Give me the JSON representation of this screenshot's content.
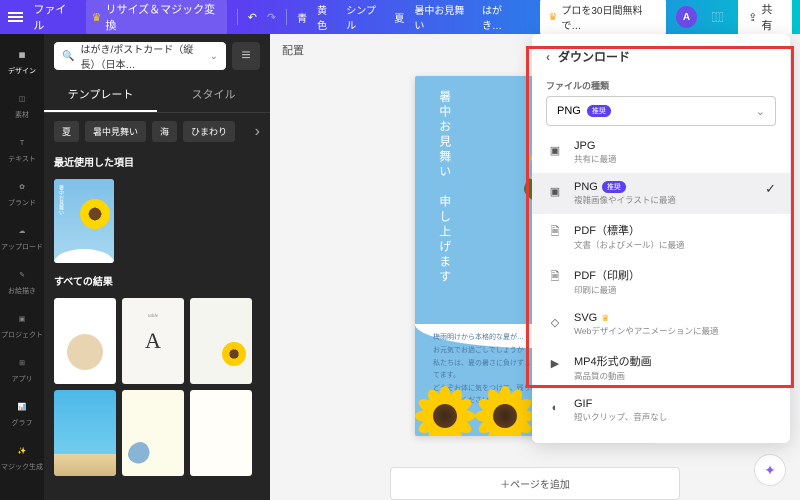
{
  "topbar": {
    "file": "ファイル",
    "resize": "リサイズ＆マジック変換",
    "tag_blue": "青",
    "tag_yellow": "黄色",
    "tag_simple": "シンプル",
    "tag_summer": "夏",
    "tag_greeting": "暑中お見舞い",
    "tag_postcard": "はがき…",
    "pro": "プロを30日間無料で…",
    "avatar": "A",
    "share": "共有"
  },
  "rail": {
    "design": "デザイン",
    "elements": "素材",
    "text": "テキスト",
    "brand": "ブランド",
    "upload": "アップロード",
    "draw": "お絵描き",
    "projects": "プロジェクト",
    "apps": "アプリ",
    "graph": "グラフ",
    "magic": "マジック生成"
  },
  "sidepanel": {
    "search_value": "はがき/ポストカード（縦長）（日本…",
    "tab_templates": "テンプレート",
    "tab_styles": "スタイル",
    "chips": [
      "夏",
      "暑中見舞い",
      "海",
      "ひまわり"
    ],
    "recent_title": "最近使用した項目",
    "results_title": "すべての結果",
    "gc2_letter": "A"
  },
  "canvas": {
    "header": "配置",
    "postcard_line1": "暑中お見舞い",
    "postcard_line2": "申し上げます",
    "body": "梅雨明けから本格的な夏が…\nお元気でお過ごしでしょうか\n私たちは、夏の暑さに負けず…\nてます。\nどうぞお体に気をつけて、残りの夏も楽しく\nお過ごしください。",
    "add_page": "＋ページを追加"
  },
  "download": {
    "title": "ダウンロード",
    "file_type_label": "ファイルの種類",
    "selected": "PNG",
    "badge": "推奨",
    "options": [
      {
        "name": "JPG",
        "desc": "共有に最適",
        "icon": "img"
      },
      {
        "name": "PNG",
        "desc": "複雑画像やイラストに最適",
        "icon": "img",
        "badge": "推奨",
        "selected": true
      },
      {
        "name": "PDF（標準）",
        "desc": "文書（およびメール）に最適",
        "icon": "doc"
      },
      {
        "name": "PDF（印刷）",
        "desc": "印刷に最適",
        "icon": "doc"
      },
      {
        "name": "SVG",
        "desc": "Webデザインやアニメーションに最適",
        "icon": "svg",
        "gold": true
      },
      {
        "name": "MP4形式の動画",
        "desc": "高品質の動画",
        "icon": "vid"
      },
      {
        "name": "GIF",
        "desc": "短いクリップ、音声なし",
        "icon": "gif"
      }
    ]
  }
}
